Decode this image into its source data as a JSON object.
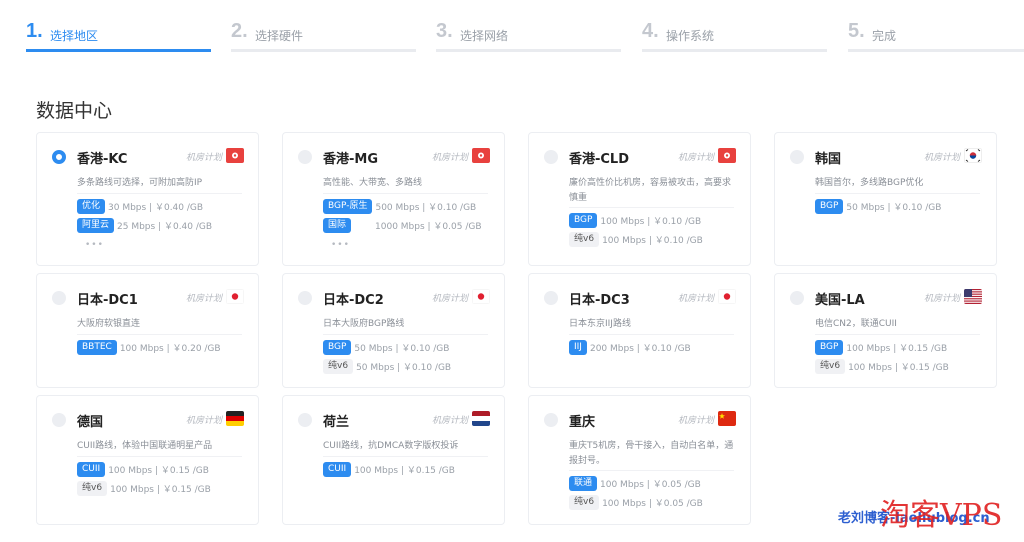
{
  "steps": [
    {
      "num": "1.",
      "label": "选择地区",
      "active": true
    },
    {
      "num": "2.",
      "label": "选择硬件",
      "active": false
    },
    {
      "num": "3.",
      "label": "选择网络",
      "active": false
    },
    {
      "num": "4.",
      "label": "操作系统",
      "active": false
    },
    {
      "num": "5.",
      "label": "完成",
      "active": false
    }
  ],
  "section_title": "数据中心",
  "plan_tag": "机房计划",
  "more": "•••",
  "cards": [
    {
      "name": "香港-KC",
      "selected": true,
      "flag": "hk",
      "desc": "多条路线可选择，可附加高防IP",
      "lines": [
        {
          "badge": "优化",
          "info": "30 Mbps | ￥0.40 /GB"
        },
        {
          "badge": "阿里云",
          "info": "25 Mbps | ￥0.40 /GB"
        }
      ]
    },
    {
      "name": "香港-MG",
      "selected": false,
      "flag": "hk",
      "desc": "高性能、大带宽、多路线",
      "lines": [
        {
          "badge": "BGP-原生",
          "info": "500 Mbps | ￥0.10 /GB"
        },
        {
          "badge": "国际",
          "info": "1000 Mbps | ￥0.05 /GB"
        }
      ]
    },
    {
      "name": "香港-CLD",
      "selected": false,
      "flag": "hk",
      "desc": "廉价高性价比机房，容易被攻击，高要求慎重",
      "lines": [
        {
          "badge": "BGP",
          "info": "100 Mbps | ￥0.10 /GB"
        },
        {
          "badge": "纯v6",
          "grey": true,
          "info": "100 Mbps | ￥0.10 /GB"
        }
      ]
    },
    {
      "name": "韩国",
      "selected": false,
      "flag": "kr",
      "desc": "韩国首尔，多线路BGP优化",
      "lines": [
        {
          "badge": "BGP",
          "info": "50 Mbps | ￥0.10 /GB"
        }
      ]
    },
    {
      "name": "日本-DC1",
      "selected": false,
      "flag": "jp",
      "desc": "大阪府软银直连",
      "lines": [
        {
          "badge": "BBTEC",
          "info": "100 Mbps | ￥0.20 /GB"
        }
      ]
    },
    {
      "name": "日本-DC2",
      "selected": false,
      "flag": "jp",
      "desc": "日本大阪府BGP路线",
      "lines": [
        {
          "badge": "BGP",
          "info": "50 Mbps | ￥0.10 /GB"
        },
        {
          "badge": "纯v6",
          "grey": true,
          "info": "50 Mbps | ￥0.10 /GB"
        }
      ]
    },
    {
      "name": "日本-DC3",
      "selected": false,
      "flag": "jp",
      "desc": "日本东京IIJ路线",
      "lines": [
        {
          "badge": "IIJ",
          "info": "200 Mbps | ￥0.10 /GB"
        }
      ]
    },
    {
      "name": "美国-LA",
      "selected": false,
      "flag": "us",
      "desc": "电信CN2，联通CUII",
      "lines": [
        {
          "badge": "BGP",
          "info": "100 Mbps | ￥0.15 /GB"
        },
        {
          "badge": "纯v6",
          "grey": true,
          "info": "100 Mbps | ￥0.15 /GB"
        }
      ]
    },
    {
      "name": "德国",
      "selected": false,
      "flag": "de",
      "desc": "CUII路线，体验中国联通明星产品",
      "lines": [
        {
          "badge": "CUII",
          "info": "100 Mbps | ￥0.15 /GB"
        },
        {
          "badge": "纯v6",
          "grey": true,
          "info": "100 Mbps | ￥0.15 /GB"
        }
      ]
    },
    {
      "name": "荷兰",
      "selected": false,
      "flag": "nl",
      "desc": "CUII路线，抗DMCA数字版权投诉",
      "lines": [
        {
          "badge": "CUII",
          "info": "100 Mbps | ￥0.15 /GB"
        }
      ]
    },
    {
      "name": "重庆",
      "selected": false,
      "flag": "cn",
      "desc": "重庆T5机房，骨干接入，自动白名单，通报封号。",
      "lines": [
        {
          "badge": "联通",
          "info": "100 Mbps | ￥0.05 /GB"
        },
        {
          "badge": "纯v6",
          "grey": true,
          "info": "100 Mbps | ￥0.05 /GB"
        }
      ]
    }
  ],
  "watermark": {
    "blog": "老刘博客-laoliublog.cn",
    "vps": "淘客VPS"
  }
}
